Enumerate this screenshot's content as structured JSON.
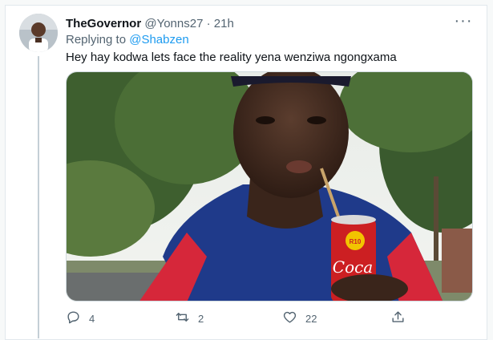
{
  "tweet": {
    "display_name": "TheGovernor",
    "handle": "@Yonns27",
    "separator": "·",
    "time": "21h",
    "replying_prefix": "Replying to",
    "replying_to": "@Shabzen",
    "text": "Hey hay kodwa lets face the reality yena wenziwa ngongxama",
    "more_icon": "more-horizontal-icon",
    "image_description_icon": "photo",
    "can_label": "Coca",
    "price_badge": "R10"
  },
  "actions": [
    {
      "icon": "reply-icon",
      "count": "4"
    },
    {
      "icon": "retweet-icon",
      "count": "2"
    },
    {
      "icon": "like-icon",
      "count": "22"
    },
    {
      "icon": "share-icon",
      "count": ""
    }
  ],
  "colors": {
    "text": "#0f1419",
    "secondary": "#536471",
    "accent": "#1d9bf0",
    "border": "#e1e8ed",
    "shirt_blue": "#1f3a8a",
    "shirt_red": "#d6273a",
    "can_red": "#cc1f22"
  }
}
